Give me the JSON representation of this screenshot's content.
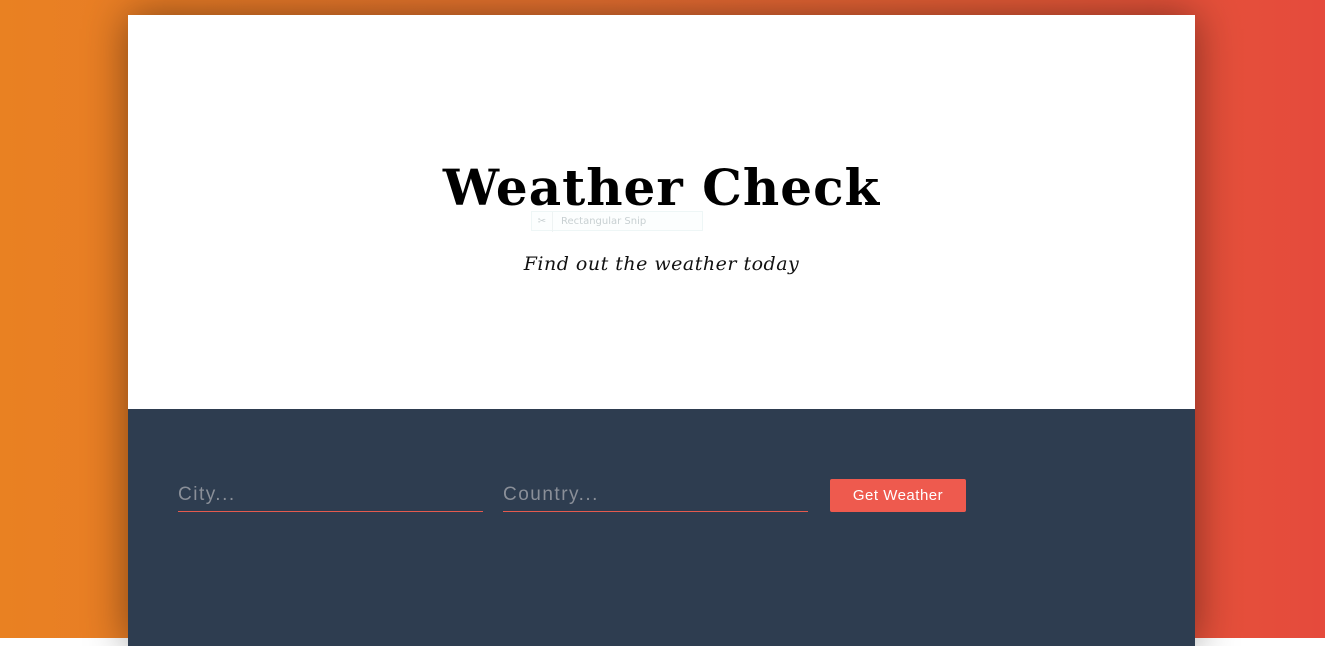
{
  "hero": {
    "title": "Weather Check",
    "subtitle": "Find out the weather today"
  },
  "snip_overlay": {
    "icon": "scissors-icon",
    "label": "Rectangular Snip"
  },
  "form": {
    "city_placeholder": "City...",
    "country_placeholder": "Country...",
    "submit_label": "Get Weather"
  },
  "colors": {
    "gradient_left": "#e98122",
    "gradient_right": "#e54a3c",
    "panel": "#2e3d50",
    "accent": "#ee5a4e"
  }
}
